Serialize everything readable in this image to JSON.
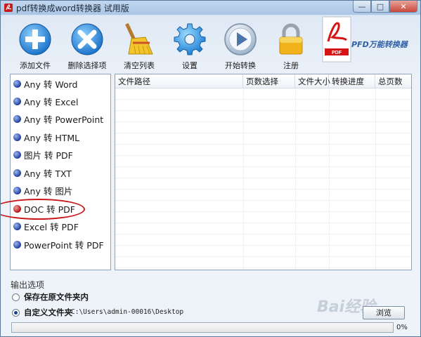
{
  "window": {
    "title": "pdf转换成word转换器 试用版",
    "minimize_glyph": "—",
    "maximize_glyph": "□",
    "close_glyph": "✕"
  },
  "toolbar": {
    "add_file": "添加文件",
    "delete_selected": "删除选择项",
    "clear_list": "清空列表",
    "settings": "设置",
    "start_convert": "开始转换",
    "register": "注册",
    "brand_name": "PFD万能转换器"
  },
  "conversions": [
    {
      "label": "Any 转 Word"
    },
    {
      "label": "Any 转 Excel"
    },
    {
      "label": "Any 转 PowerPoint"
    },
    {
      "label": "Any 转 HTML"
    },
    {
      "label": "图片 转 PDF"
    },
    {
      "label": "Any 转 TXT"
    },
    {
      "label": "Any 转 图片"
    },
    {
      "label": "DOC 转 PDF"
    },
    {
      "label": "Excel 转 PDF"
    },
    {
      "label": "PowerPoint 转 PDF"
    }
  ],
  "selected_conversion": "DOC 转 PDF",
  "table": {
    "columns": [
      "文件路径",
      "页数选择",
      "文件大小",
      "转换进度",
      "总页数"
    ]
  },
  "output": {
    "title": "输出选项",
    "option_original": "保存在原文件夹内",
    "option_custom": "自定义文件夹",
    "custom_path": "C:\\Users\\admin-00016\\Desktop",
    "browse_label": "浏览"
  },
  "progress": {
    "value": 0,
    "label": "0%"
  },
  "watermark": "Bai经验",
  "colors": {
    "accent_blue": "#2f7fd8",
    "highlight_red": "#c8181a",
    "progress_green": "#2f9a2f"
  }
}
